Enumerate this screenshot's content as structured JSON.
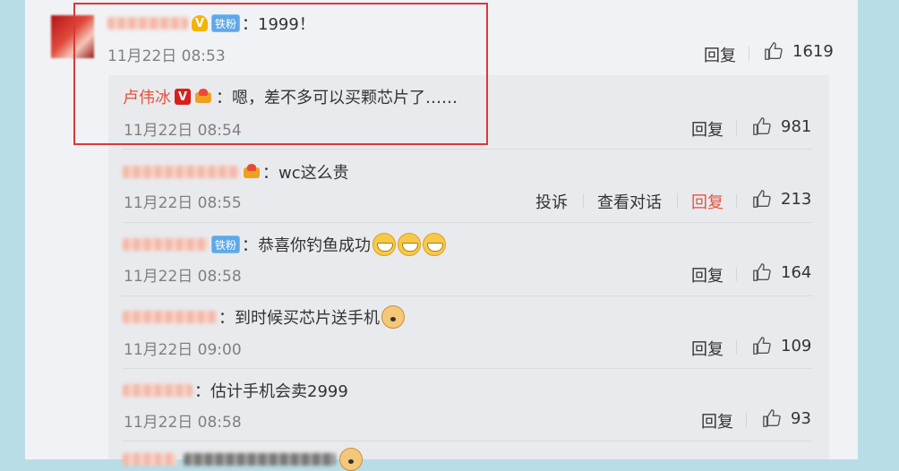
{
  "main_comment": {
    "text": "：1999！",
    "time": "11月22日 08:53",
    "reply_label": "回复",
    "likes": "1619",
    "badge_label": "铁粉"
  },
  "replies": [
    {
      "name": "卢伟冰",
      "text": "：嗯，差不多可以买颗芯片了……",
      "time": "11月22日 08:54",
      "reply_label": "回复",
      "likes": "981"
    },
    {
      "text": "：wc这么贵",
      "time": "11月22日 08:55",
      "report_label": "投诉",
      "view_dialog_label": "查看对话",
      "reply_label": "回复",
      "likes": "213"
    },
    {
      "badge_label": "铁粉",
      "text": "：恭喜你钓鱼成功",
      "time": "11月22日 08:58",
      "reply_label": "回复",
      "likes": "164"
    },
    {
      "text": "：到时候买芯片送手机",
      "time": "11月22日 09:00",
      "reply_label": "回复",
      "likes": "109"
    },
    {
      "text": "：估计手机会卖2999",
      "time": "11月22日 08:58",
      "reply_label": "回复",
      "likes": "93"
    }
  ],
  "colors": {
    "accent_red": "#e3533a",
    "highlight_border": "#d9383a",
    "badge_blue": "#5fa8e8"
  },
  "icons": {
    "like": "thumbs-up-icon",
    "verified": "verified-v-icon",
    "crown": "crown-icon",
    "grin": "grin-emoji-icon",
    "doge": "doge-emoji-icon"
  }
}
